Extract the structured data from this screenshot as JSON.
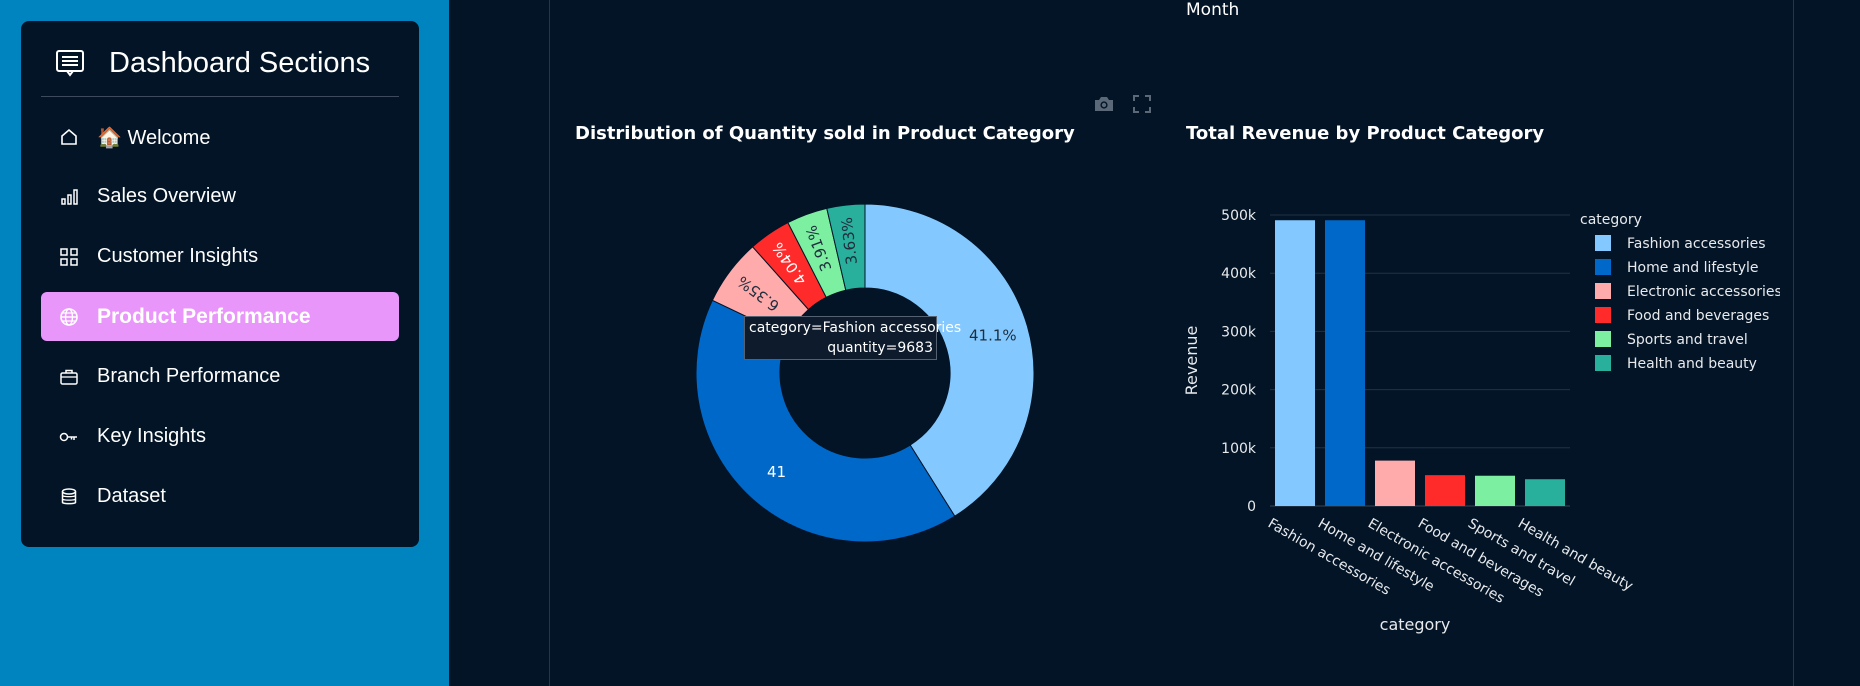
{
  "sidebar": {
    "title": "Dashboard Sections",
    "items": [
      {
        "label": "🏠 Welcome",
        "icon": "home-icon",
        "active": false
      },
      {
        "label": "Sales Overview",
        "icon": "bar-chart-icon",
        "active": false
      },
      {
        "label": "Customer Insights",
        "icon": "grid-icon",
        "active": false
      },
      {
        "label": "Product Performance",
        "icon": "globe-icon",
        "active": true
      },
      {
        "label": "Branch Performance",
        "icon": "briefcase-icon",
        "active": false
      },
      {
        "label": "Key Insights",
        "icon": "key-icon",
        "active": false
      },
      {
        "label": "Dataset",
        "icon": "database-icon",
        "active": false
      }
    ],
    "active_color": "#e996fb",
    "background": "#0084bf"
  },
  "main": {
    "axis_fragment": "Month",
    "toolbar": {
      "camera_icon": "camera-icon",
      "fullscreen_icon": "fullscreen-icon"
    }
  },
  "charts": {
    "pie_title": "Distribution of Quantity sold in Product Category",
    "bar_title": "Total Revenue by Product Category",
    "tooltip": {
      "line1": "category=Fashion accessories",
      "line2": "quantity=9683"
    }
  },
  "chart_data": [
    {
      "type": "pie",
      "hole": true,
      "slices": [
        {
          "label": "Fashion accessories",
          "value": 41.1,
          "display": "41.1%",
          "color": "#83c9ff"
        },
        {
          "label": "Home and lifestyle",
          "value": 41.0,
          "display": "41",
          "color": "#0068c9"
        },
        {
          "label": "Electronic accessories",
          "value": 6.35,
          "display": "6.35%",
          "color": "#ffabab"
        },
        {
          "label": "Food and beverages",
          "value": 4.04,
          "display": "4.04%",
          "color": "#ff2b2b"
        },
        {
          "label": "Sports and travel",
          "value": 3.91,
          "display": "3.91%",
          "color": "#7defa1"
        },
        {
          "label": "Health and beauty",
          "value": 3.63,
          "display": "3.63%",
          "color": "#29b09d"
        }
      ]
    },
    {
      "type": "bar",
      "categories": [
        "Fashion accessories",
        "Home and lifestyle",
        "Electronic accessories",
        "Food and beverages",
        "Sports and travel",
        "Health and beauty"
      ],
      "values": [
        491000,
        491000,
        78000,
        53000,
        52000,
        46000
      ],
      "colors": [
        "#83c9ff",
        "#0068c9",
        "#ffabab",
        "#ff2b2b",
        "#7defa1",
        "#29b09d"
      ],
      "xlabel": "category",
      "ylabel": "Revenue",
      "ylim": [
        0,
        500000
      ],
      "yticks": [
        0,
        100000,
        200000,
        300000,
        400000,
        500000
      ],
      "ytick_labels": [
        "0",
        "100k",
        "200k",
        "300k",
        "400k",
        "500k"
      ],
      "legend_title": "category",
      "legend_position": "top-right",
      "grid": true
    }
  ]
}
